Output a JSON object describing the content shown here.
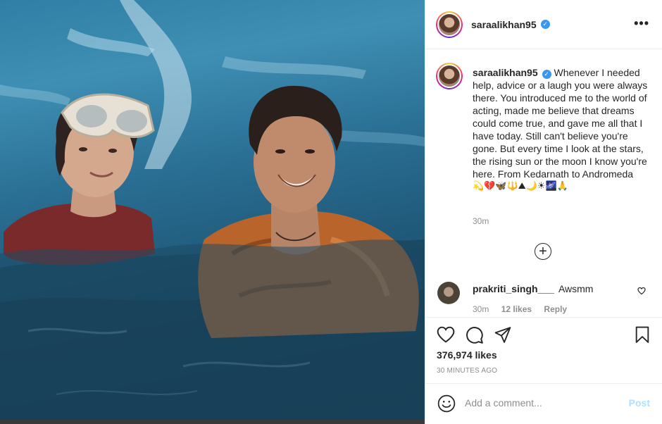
{
  "post": {
    "username": "saraalikhan95",
    "verified_symbol": "✓",
    "more_symbol": "•••",
    "caption_text": "Whenever I needed help, advice or a laugh you were always there. You introduced me to the world of acting, made me believe that dreams could come true, and gave me all that I have today. Still can't believe you're gone. But every time I look at the stars, the rising sun or the moon I know you're here. From Kedarnath to Andromeda",
    "caption_emojis": "💫💔🦋🔱⛰🌙☀🌌🙏",
    "caption_time": "30m",
    "load_more_symbol": "+"
  },
  "comment": {
    "username": "prakriti_singh___",
    "text": "Awsmm",
    "time": "30m",
    "likes": "12 likes",
    "reply_label": "Reply"
  },
  "actions": {
    "likes_count": "376,974 likes",
    "time_ago": "30 MINUTES AGO"
  },
  "add_comment": {
    "placeholder": "Add a comment...",
    "post_label": "Post"
  },
  "colors": {
    "accent_blue": "#3897f0",
    "post_disabled": "#b2dffc",
    "meta_gray": "#8e8e8e",
    "text": "#262626"
  },
  "icons": [
    "heart-icon",
    "comment-icon",
    "share-icon",
    "bookmark-icon",
    "smiley-icon",
    "more-options-icon",
    "plus-circle-icon",
    "verified-badge-icon"
  ]
}
